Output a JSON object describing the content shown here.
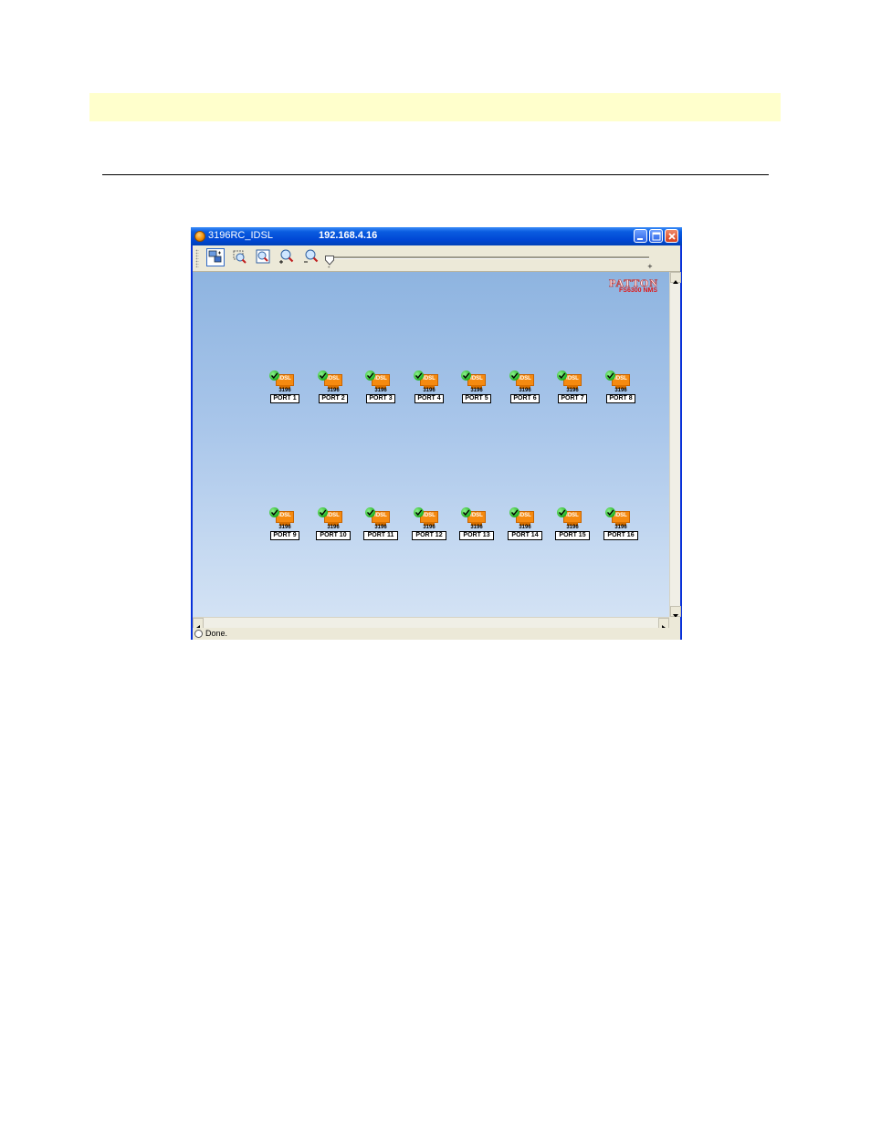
{
  "window": {
    "title": "3196RC_IDSL",
    "ip_address": "192.168.4.16"
  },
  "toolbar": {
    "tools": [
      {
        "icon": "select-pan-icon",
        "pressed": true
      },
      {
        "icon": "zoom-select-icon"
      },
      {
        "icon": "zoom-fit-icon"
      },
      {
        "icon": "zoom-in-icon"
      },
      {
        "icon": "zoom-out-icon"
      }
    ],
    "zoom_min_label": "-",
    "zoom_max_label": "+"
  },
  "logo": {
    "brand": "PATTON",
    "product": "FS6300 NMS"
  },
  "ports_row1": [
    {
      "device": "IDSL",
      "model": "3196",
      "label": "PORT 1",
      "status": "ok"
    },
    {
      "device": "IDSL",
      "model": "3196",
      "label": "PORT 2",
      "status": "ok"
    },
    {
      "device": "IDSL",
      "model": "3196",
      "label": "PORT 3",
      "status": "ok"
    },
    {
      "device": "IDSL",
      "model": "3196",
      "label": "PORT 4",
      "status": "ok"
    },
    {
      "device": "IDSL",
      "model": "3196",
      "label": "PORT 5",
      "status": "ok"
    },
    {
      "device": "IDSL",
      "model": "3196",
      "label": "PORT 6",
      "status": "ok"
    },
    {
      "device": "IDSL",
      "model": "3196",
      "label": "PORT 7",
      "status": "ok"
    },
    {
      "device": "IDSL",
      "model": "3196",
      "label": "PORT 8",
      "status": "ok"
    }
  ],
  "ports_row2": [
    {
      "device": "IDSL",
      "model": "3196",
      "label": "PORT 9",
      "status": "ok"
    },
    {
      "device": "IDSL",
      "model": "3196",
      "label": "PORT 10",
      "status": "ok"
    },
    {
      "device": "IDSL",
      "model": "3196",
      "label": "PORT 11",
      "status": "ok"
    },
    {
      "device": "IDSL",
      "model": "3196",
      "label": "PORT 12",
      "status": "ok"
    },
    {
      "device": "IDSL",
      "model": "3196",
      "label": "PORT 13",
      "status": "ok"
    },
    {
      "device": "IDSL",
      "model": "3196",
      "label": "PORT 14",
      "status": "ok"
    },
    {
      "device": "IDSL",
      "model": "3196",
      "label": "PORT 15",
      "status": "ok"
    },
    {
      "device": "IDSL",
      "model": "3196",
      "label": "PORT 16",
      "status": "ok"
    }
  ],
  "status_bar": {
    "text": "Done."
  },
  "colors": {
    "titlebar": "#0a5ce0",
    "device": "#f58a10",
    "status_ok": "#20b020",
    "logo_red": "#e01818",
    "page_band": "#ffffcc"
  }
}
